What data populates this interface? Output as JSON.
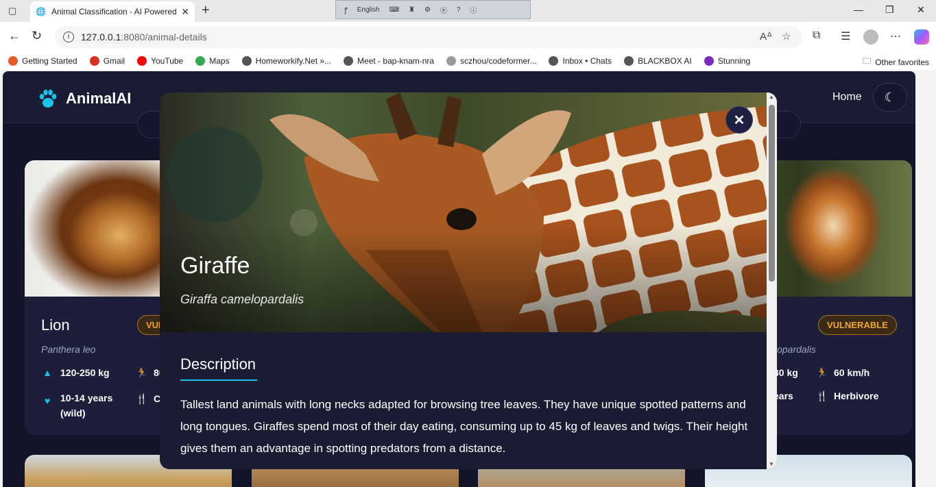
{
  "browser": {
    "tab_title": "Animal Classification - AI Powered",
    "lang_bar_label": "English",
    "url_host": "127.0.0.1",
    "url_rest": ":8080/animal-details",
    "bookmarks": [
      {
        "label": "Getting Started",
        "color": "#e55b2b"
      },
      {
        "label": "Gmail",
        "color": "#d93025"
      },
      {
        "label": "YouTube",
        "color": "#ff0000"
      },
      {
        "label": "Maps",
        "color": "#34a853"
      },
      {
        "label": "Homeworkify.Net »...",
        "color": "#555555"
      },
      {
        "label": "Meet - bap-knam-nra",
        "color": "#555555"
      },
      {
        "label": "sczhou/codeformer...",
        "color": "#999999"
      },
      {
        "label": "Inbox • Chats",
        "color": "#555555"
      },
      {
        "label": "BLACKBOX AI",
        "color": "#555555"
      },
      {
        "label": "Stunning",
        "color": "#7b2cbf"
      }
    ],
    "other_favorites": "Other favorites"
  },
  "site": {
    "logo_text": "AnimalAI",
    "nav_home": "Home",
    "accent_color": "#18c2ea"
  },
  "cards": {
    "lion": {
      "name": "Lion",
      "badge": "VUL",
      "scientific": "Panthera leo",
      "weight": "120-250 kg",
      "speed": "80",
      "lifespan_line1": "10-14 years",
      "lifespan_line2": "(wild)",
      "diet": "Ca"
    },
    "giraffe": {
      "badge": "VULNERABLE",
      "scientific": "lopardalis",
      "weight": "30 kg",
      "speed": "60 km/h",
      "lifespan": "ears",
      "diet": "Herbivore"
    }
  },
  "modal": {
    "title": "Giraffe",
    "scientific": "Giraffa camelopardalis",
    "section_title": "Description",
    "description": "Tallest land animals with long necks adapted for browsing tree leaves. They have unique spotted patterns and long tongues. Giraffes spend most of their day eating, consuming up to 45 kg of leaves and twigs. Their height gives them an advantage in spotting predators from a distance.",
    "close_symbol": "✕"
  }
}
